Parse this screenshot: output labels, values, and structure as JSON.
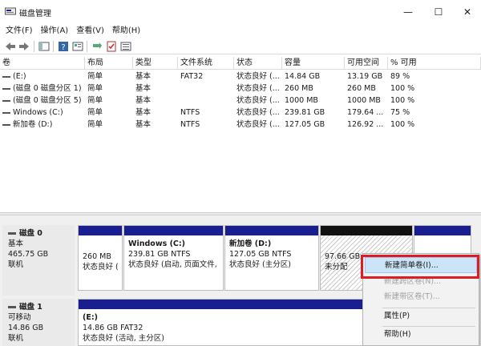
{
  "window": {
    "title": "磁盘管理",
    "minimize_glyph": "—",
    "maximize_glyph": "☐",
    "close_glyph": "✕"
  },
  "menu": [
    "文件(F)",
    "操作(A)",
    "查看(V)",
    "帮助(H)"
  ],
  "toolbar": {
    "icons": [
      "back-arrow-icon",
      "forward-arrow-icon",
      "console-tree-icon",
      "help-icon",
      "properties-icon",
      "connect-icon",
      "checklist-icon",
      "list-view-icon"
    ]
  },
  "volume_table": {
    "headers": [
      "卷",
      "布局",
      "类型",
      "文件系统",
      "状态",
      "容量",
      "可用空间",
      "% 可用"
    ],
    "rows": [
      [
        "(E:)",
        "简单",
        "基本",
        "FAT32",
        "状态良好 (...",
        "14.84 GB",
        "13.19 GB",
        "89 %"
      ],
      [
        "(磁盘 0 磁盘分区 1)",
        "简单",
        "基本",
        "",
        "状态良好 (...",
        "260 MB",
        "260 MB",
        "100 %"
      ],
      [
        "(磁盘 0 磁盘分区 5)",
        "简单",
        "基本",
        "",
        "状态良好 (...",
        "1000 MB",
        "1000 MB",
        "100 %"
      ],
      [
        "Windows (C:)",
        "简单",
        "基本",
        "NTFS",
        "状态良好 (...",
        "239.81 GB",
        "179.64 ...",
        "75 %"
      ],
      [
        "新加卷 (D:)",
        "简单",
        "基本",
        "NTFS",
        "状态良好 (...",
        "127.05 GB",
        "126.92 ...",
        "100 %"
      ]
    ]
  },
  "disks": [
    {
      "name": "磁盘 0",
      "type": "基本",
      "size": "465.75 GB",
      "status": "联机",
      "partitions": [
        {
          "name": "",
          "size": "260 MB",
          "status": "状态良好 ("
        },
        {
          "name": "Windows  (C:)",
          "size": "239.81 GB NTFS",
          "status": "状态良好 (启动, 页面文件,"
        },
        {
          "name": "新加卷  (D:)",
          "size": "127.05 GB NTFS",
          "status": "状态良好 (主分区)"
        },
        {
          "name": "",
          "size": "97.66 GB",
          "status": "未分配"
        }
      ]
    },
    {
      "name": "磁盘 1",
      "type": "可移动",
      "size": "14.86 GB",
      "status": "联机",
      "partitions": [
        {
          "name": "(E:)",
          "size": "14.86 GB FAT32",
          "status": "状态良好 (活动, 主分区)"
        }
      ]
    }
  ],
  "context_menu": {
    "items": [
      {
        "label": "新建简单卷(I)...",
        "enabled": true
      },
      {
        "label": "新建跨区卷(N)...",
        "enabled": false
      },
      {
        "label": "新建带区卷(T)...",
        "enabled": false
      },
      {
        "label": "属性(P)",
        "enabled": true
      },
      {
        "label": "帮助(H)",
        "enabled": true
      }
    ]
  },
  "colors": {
    "partition_bar": "#1a1f8f",
    "unallocated_bar": "#111111",
    "highlight_box": "#e01b24",
    "menu_highlight": "#cce4f7"
  }
}
